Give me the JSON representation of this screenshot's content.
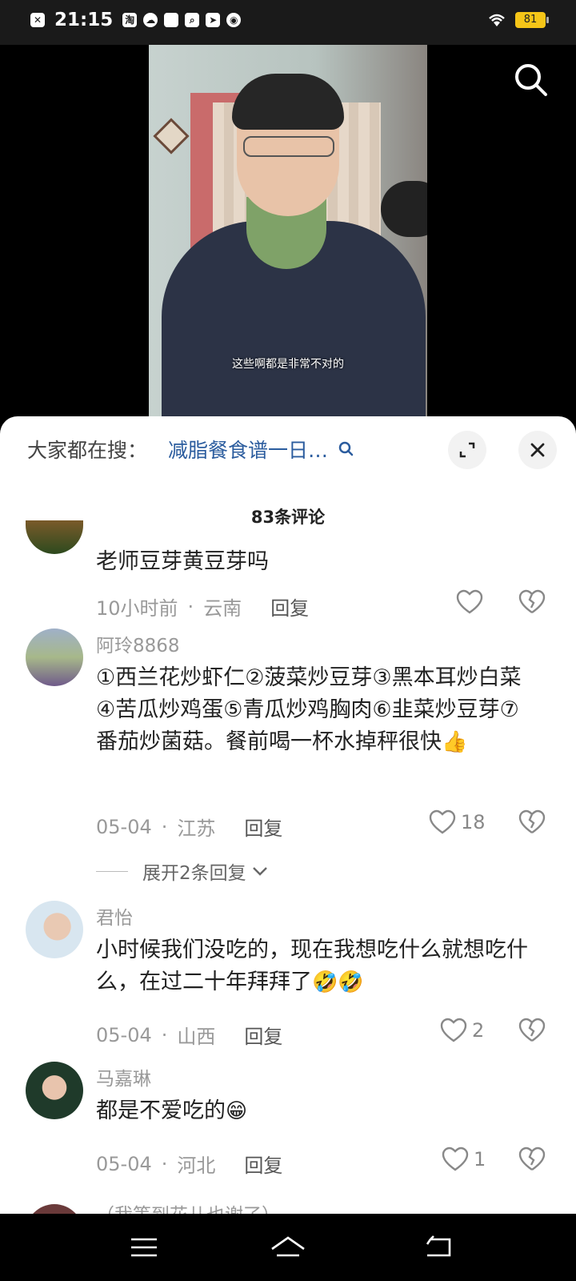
{
  "status_bar": {
    "time": "21:15",
    "icons": [
      "x-icon",
      "taobao-icon",
      "cloud-icon",
      "app-icon",
      "search-app-icon",
      "telegram-icon",
      "weibo-icon"
    ],
    "battery": "81"
  },
  "video": {
    "subtitle": "这些啊都是非常不对的"
  },
  "sheet": {
    "search_label": "大家都在搜：",
    "search_query": "减脂餐食谱一日…",
    "comment_count": "83条评论"
  },
  "comments": [
    {
      "user": "",
      "text": "老师豆芽黄豆芽吗",
      "time": "10小时前",
      "location": "云南",
      "reply_label": "回复",
      "likes": ""
    },
    {
      "user": "阿玲8868",
      "text": "①西兰花炒虾仁②菠菜炒豆芽③黑本耳炒白菜④苦瓜炒鸡蛋⑤青瓜炒鸡胸肉⑥韭菜炒豆芽⑦番茄炒菌菇。餐前喝一杯水掉秤很快",
      "emoji": "👍",
      "time": "05-04",
      "location": "江苏",
      "reply_label": "回复",
      "likes": "18",
      "expand_label": "展开2条回复"
    },
    {
      "user": "君怡",
      "text": "小时候我们没吃的，现在我想吃什么就想吃什么，在过二十年拜拜了",
      "emoji": "🤣🤣",
      "time": "05-04",
      "location": "山西",
      "reply_label": "回复",
      "likes": "2"
    },
    {
      "user": "马嘉琳",
      "text": "都是不爱吃的",
      "emoji": "😁",
      "time": "05-04",
      "location": "河北",
      "reply_label": "回复",
      "likes": "1"
    },
    {
      "user": "（我等到花儿也谢了）"
    }
  ]
}
